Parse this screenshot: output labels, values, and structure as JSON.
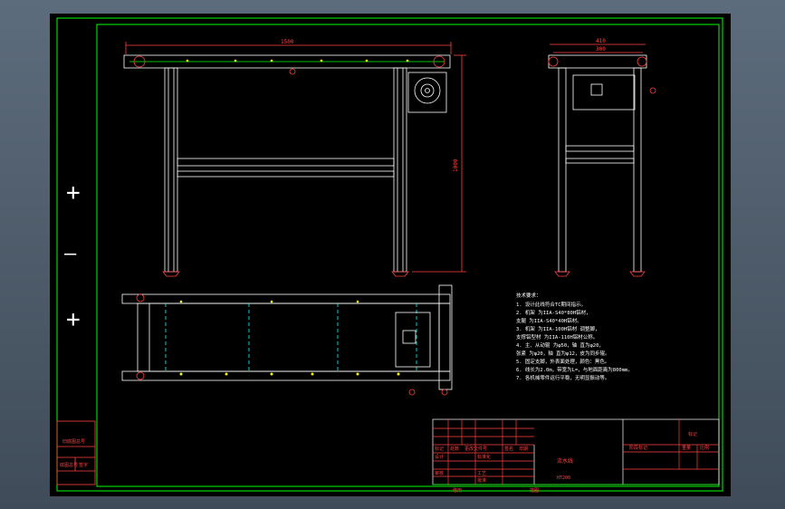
{
  "colors": {
    "border": "#00ff00",
    "frame": "#ffffff",
    "dimension": "#ff4040",
    "hidden": "#00ffff",
    "accent": "#ffff00"
  },
  "zoom_controls": [
    "+",
    "—",
    "+"
  ],
  "dimensions": {
    "length": "1500",
    "height": "1000",
    "side_width_outer": "410",
    "side_width_inner": "300"
  },
  "notes": {
    "title": "技术要求：",
    "items": [
      "1. 设计此线符合TC期间指示。",
      "2. 机架 为IIA-S40*80H铝材，",
      "   支腿 为IIA-S40*40H铝材。",
      "3. 机架 为IIA-100H铝材 调整脚，",
      "   支撑铝型材 为IIA-110H铝材公称。",
      "4. 主、从动辊 为φ50，轴 直为φ20，",
      "   张紧 为φ20，轴 直为φ12，皮为同步辊。",
      "5. 固定支脚，外表面处理，颜色：黑色。",
      "6. 线长为2.0m，带宽为L=，与地面距离为800mm。",
      "7. 各机械零件运行平稳，无明显振动等。"
    ]
  },
  "title_block": {
    "drawing_name": "流水线",
    "material": "HT200",
    "header_cells": [
      "标记",
      "处数",
      "分区",
      "更改文件号",
      "签名",
      "日期"
    ],
    "role_cells": [
      "设计",
      "标准化",
      "审核",
      "工艺",
      "批准"
    ],
    "right_cells": [
      "阶段标记",
      "重量",
      "比例"
    ],
    "label_top": "标记",
    "footer_cells": [
      "借用",
      "描图"
    ],
    "left_stamp": [
      "借(通)用件登记",
      "旧底图总号",
      "底图总号",
      "签字"
    ]
  }
}
